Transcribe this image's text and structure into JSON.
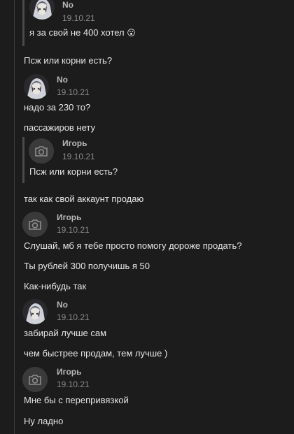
{
  "messages": {
    "quote1": {
      "author": "No",
      "date": "19.10.21",
      "text": "я за свой не 400 хотел",
      "emoji": "😮"
    },
    "m1_text": "Псж или корни есть?",
    "block_no_1": {
      "author": "No",
      "date": "19.10.21",
      "lines": [
        "надо за 230 то?",
        "пассажиров нету"
      ]
    },
    "quote2": {
      "author": "Игорь",
      "date": "19.10.21",
      "text": "Псж или корни есть?"
    },
    "m2_text": "так как свой аккаунт продаю",
    "block_igor_1": {
      "author": "Игорь",
      "date": "19.10.21",
      "lines": [
        "Слушай, мб я тебе просто помогу дороже продать?",
        "Ты рублей 300 получишь я 50",
        "Как-нибудь так"
      ]
    },
    "block_no_2": {
      "author": "No",
      "date": "19.10.21",
      "lines": [
        "забирай лучше сам",
        "чем быстрее продам, тем лучше )"
      ]
    },
    "block_igor_2": {
      "author": "Игорь",
      "date": "19.10.21",
      "lines": [
        "Мне бы с перепривязкой",
        "Ну ладно"
      ]
    }
  },
  "colors": {
    "background": "#1c1c1c",
    "text": "#e6e6e6",
    "author": "#b8b8b8",
    "date": "#8a8a8a"
  },
  "icons": {
    "camera_avatar": "camera-icon",
    "anime_avatar": "user-avatar"
  }
}
